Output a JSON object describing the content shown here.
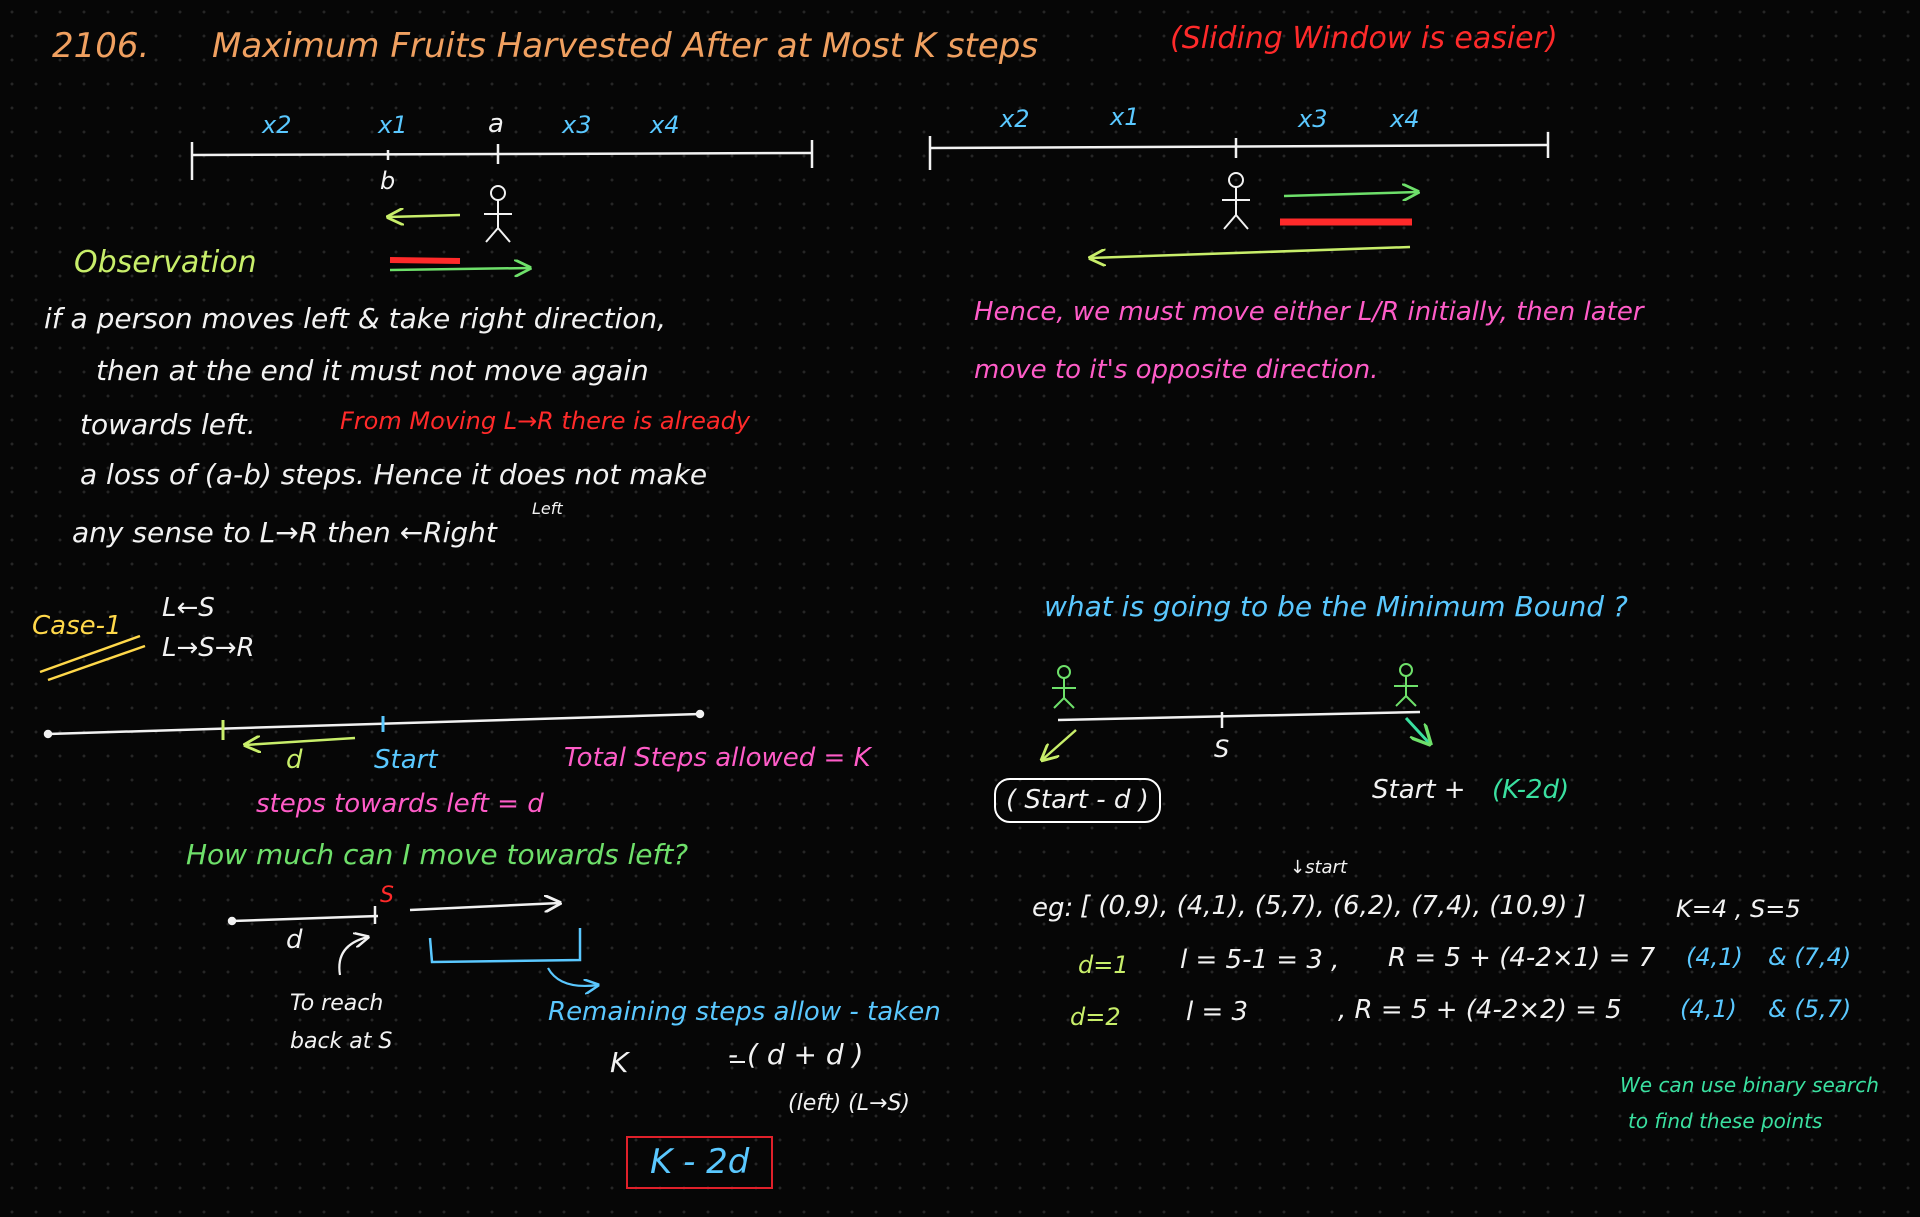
{
  "colors": {
    "orange": "#f0a060",
    "red": "#ff2a2a",
    "green": "#6ee06a",
    "lime": "#c8ee6a",
    "pink": "#ff5cc8",
    "blue": "#5ac8ff",
    "yellow": "#ffd84a",
    "white": "#f2f2f2",
    "teal": "#3ae0a0"
  },
  "title": {
    "number": "2106.",
    "text": "Maximum Fruits Harvested After at Most K steps",
    "note": "(Sliding Window is easier)"
  },
  "diagram1": {
    "labels": [
      "x2",
      "x1",
      "a",
      "x3",
      "x4"
    ],
    "b_label": "b"
  },
  "diagram2": {
    "labels": [
      "x2",
      "x1",
      "x3",
      "x4"
    ]
  },
  "observation": {
    "heading": "Observation",
    "lines": [
      "if a person moves left & take right direction,",
      "then at the end it must not move again",
      "towards left."
    ],
    "red_note": "From Moving L→R there is already",
    "lines2": [
      "a loss of (a-b) steps. Hence it does not make",
      "any sense to L→R then ←Right"
    ],
    "left_small": "Left"
  },
  "hence": {
    "line1": "Hence, we must move either L/R initially, then later",
    "line2": "move to it's opposite direction."
  },
  "cases": {
    "label": "Case-1",
    "line1": "L←S",
    "line2": "L→S→R"
  },
  "left_move": {
    "d_label": "d",
    "start_label": "Start",
    "total_steps": "Total Steps allowed = K",
    "steps_left": "steps towards left = d",
    "question": "How much can I move towards left?",
    "s_label": "S",
    "d2_label": "d",
    "return_label1": "To reach",
    "return_label2": "back at S",
    "remaining": "Remaining steps allow - taken",
    "formula_k": "K",
    "formula_rest": "- ( d + d )",
    "formula_sub": "(left)  (L→S)",
    "result": "K - 2d"
  },
  "bound": {
    "question": "what is going to be the Minimum Bound ?",
    "s_label": "S",
    "left_box": "( Start - d )",
    "right_prefix": "Start +",
    "right_expr": "(K-2d)"
  },
  "example": {
    "start_marker": "↓start",
    "eg_label": "eg:",
    "fruits": "[ (0,9), (4,1), (5,7), (6,2), (7,4), (10,9) ]",
    "k_s": "K=4 , S=5",
    "rows": [
      {
        "d": "d=1",
        "l": "l = 5-1 = 3 ,",
        "r": "R = 5 + (4-2×1) = 7",
        "p1": "(4,1)",
        "p2": "& (7,4)"
      },
      {
        "d": "d=2",
        "l": "l = 3",
        "r": ",   R = 5 + (4-2×2) = 5",
        "p1": "(4,1)",
        "p2": "& (5,7)"
      }
    ],
    "binary_note1": "We can use binary search",
    "binary_note2": "to find these points"
  }
}
